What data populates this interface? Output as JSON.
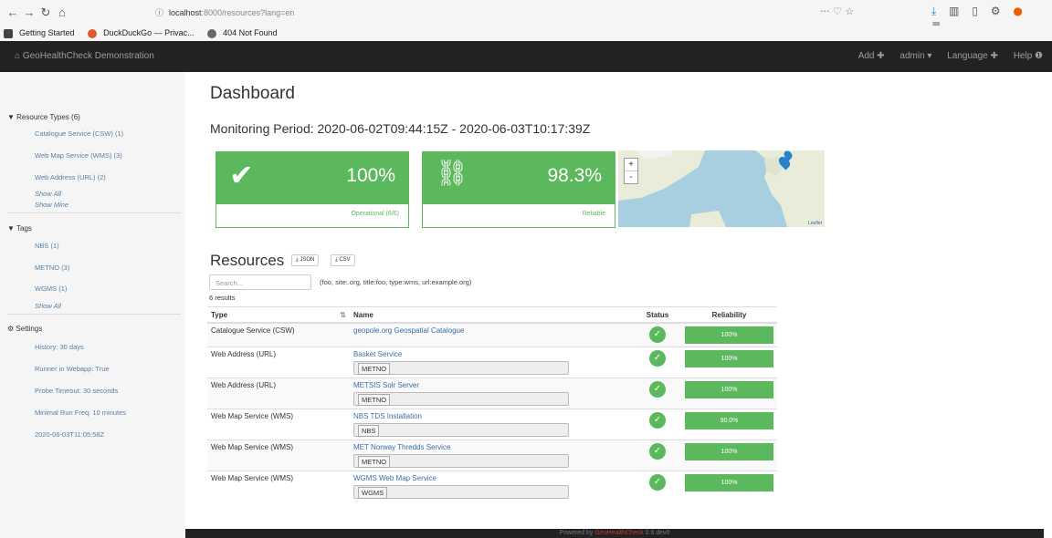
{
  "browser": {
    "url_host": "localhost",
    "url_rest": ":8000/resources?lang=en",
    "page_actions": "··· ♡ ☆",
    "bookmarks": [
      {
        "label": "Getting Started",
        "color": "#444"
      },
      {
        "label": "DuckDuckGo — Privac...",
        "color": "#de5833"
      },
      {
        "label": "404 Not Found",
        "color": "#666"
      }
    ]
  },
  "navbar": {
    "brand": "GeoHealthCheck Demonstration",
    "items": [
      "Add ✚",
      "admin ▾",
      "Language ✚",
      "Help ❶"
    ]
  },
  "sidebar": {
    "resource_types_title": "Resource Types (6)",
    "resource_types": [
      "Catalogue Service (CSW) (1)",
      "Web Map Service (WMS) (3)",
      "Web Address (URL) (2)"
    ],
    "show_all": "Show All",
    "show_mine": "Show Mine",
    "tags_title": "Tags",
    "tags": [
      "NBS (1)",
      "METNO (3)",
      "WGMS (1)"
    ],
    "tags_show_all": "Show All",
    "settings_title": "Settings",
    "settings": [
      "History: 30 days",
      "Runner in Webapp: True",
      "Probe Timeout: 30 seconds",
      "Minimal Run Freq: 10 minutes",
      "2020-06-03T11:05:58Z"
    ]
  },
  "main": {
    "title": "Dashboard",
    "period": "Monitoring Period: 2020-06-02T09:44:15Z - 2020-06-03T10:17:39Z",
    "card_operational": {
      "value": "100%",
      "footer": "Operational (6/6)"
    },
    "card_reliable": {
      "value": "98.3%",
      "footer": "Reliable"
    },
    "map_attrib": "Leaflet",
    "resources_title": "Resources",
    "json_btn": "⤓ JSON",
    "csv_btn": "⤓ CSV",
    "search_placeholder": "Search...",
    "search_hint": "(foo, site:.org, title:foo, type:wms, url:example.org)",
    "results_count": "6 results",
    "columns": {
      "type": "Type",
      "name": "Name",
      "status": "Status",
      "reliability": "Reliability"
    },
    "rows": [
      {
        "type": "Catalogue Service (CSW)",
        "name": "geopole.org Geospatial Catalogue",
        "tag": "",
        "reliability": "100%"
      },
      {
        "type": "Web Address (URL)",
        "name": "Basket Service",
        "tag": "METNO",
        "reliability": "100%"
      },
      {
        "type": "Web Address (URL)",
        "name": "METSIS Solr Server",
        "tag": "METNO",
        "reliability": "100%"
      },
      {
        "type": "Web Map Service (WMS)",
        "name": "NBS TDS Installation",
        "tag": "NBS",
        "reliability": "90.0%"
      },
      {
        "type": "Web Map Service (WMS)",
        "name": "MET Norway Thredds Service",
        "tag": "METNO",
        "reliability": "100%"
      },
      {
        "type": "Web Map Service (WMS)",
        "name": "WGMS Web Map Service",
        "tag": "WGMS",
        "reliability": "100%"
      }
    ]
  },
  "footer": {
    "prefix": "Powered by",
    "link": "GeoHealthCheck",
    "suffix": "0.6.dev0"
  },
  "colors": {
    "success": "#5cb85c",
    "navbar": "#222222",
    "link": "#3a6ea5"
  }
}
